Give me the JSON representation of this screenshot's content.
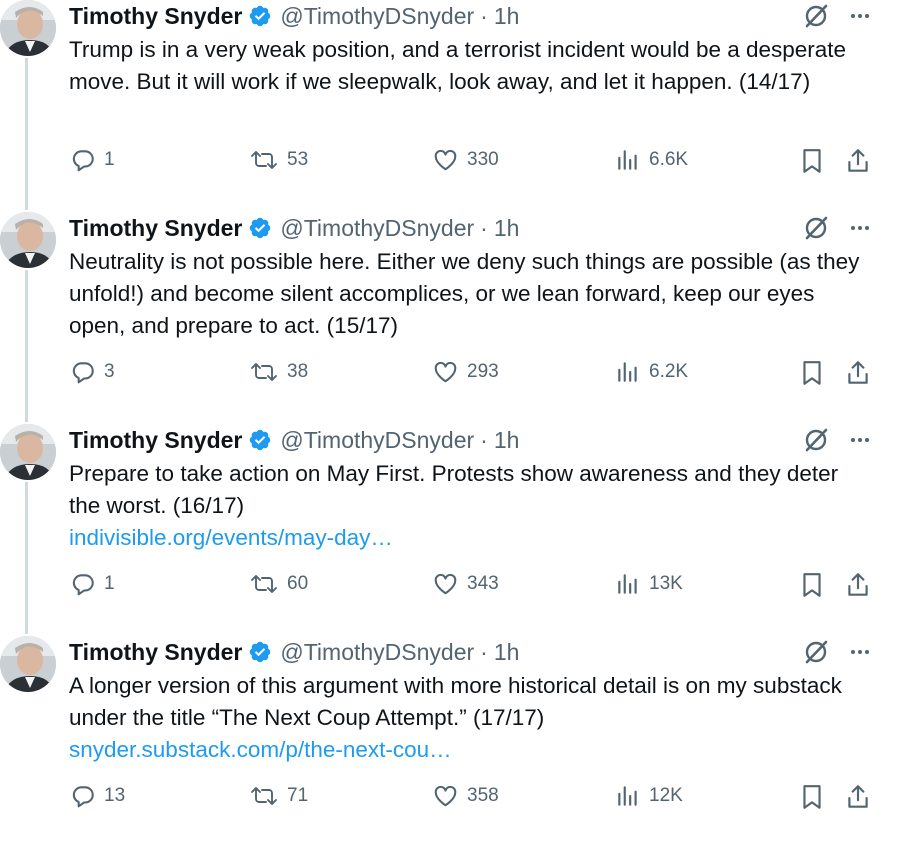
{
  "tweets": [
    {
      "author": "Timothy Snyder",
      "handle": "@TimothyDSnyder",
      "separator": "·",
      "time": "1h",
      "text": "Trump is in a very weak position, and a terrorist incident would be a desperate move. But it will work if we sleepwalk, look away, and let it happen. (14/17)",
      "link": "",
      "replies": "1",
      "reposts": "53",
      "likes": "330",
      "views": "6.6K"
    },
    {
      "author": "Timothy Snyder",
      "handle": "@TimothyDSnyder",
      "separator": "·",
      "time": "1h",
      "text": "Neutrality is not possible here. Either we deny such things are possible (as they unfold!) and become silent accomplices, or we lean forward, keep our eyes open, and prepare to act. (15/17)",
      "link": "",
      "replies": "3",
      "reposts": "38",
      "likes": "293",
      "views": "6.2K"
    },
    {
      "author": "Timothy Snyder",
      "handle": "@TimothyDSnyder",
      "separator": "·",
      "time": "1h",
      "text": "Prepare to take action on May First. Protests show awareness and they deter the worst. (16/17)",
      "link": "indivisible.org/events/may-day…",
      "replies": "1",
      "reposts": "60",
      "likes": "343",
      "views": "13K"
    },
    {
      "author": "Timothy Snyder",
      "handle": "@TimothyDSnyder",
      "separator": "·",
      "time": "1h",
      "text": "A longer version of this argument with more historical detail is on my substack under the title “The Next Coup Attempt.” (17/17)",
      "link": "snyder.substack.com/p/the-next-cou…",
      "replies": "13",
      "reposts": "71",
      "likes": "358",
      "views": "12K"
    }
  ],
  "icons": {
    "verified": "verified-badge-icon",
    "grok": "grok-icon",
    "more": "more-icon",
    "reply": "reply-icon",
    "repost": "repost-icon",
    "like": "like-icon",
    "views": "views-icon",
    "bookmark": "bookmark-icon",
    "share": "share-icon"
  },
  "colors": {
    "text": "#0f1419",
    "secondary": "#536471",
    "link": "#1d9bf0",
    "verified": "#1d9bf0",
    "thread_line": "#cfd9de"
  }
}
